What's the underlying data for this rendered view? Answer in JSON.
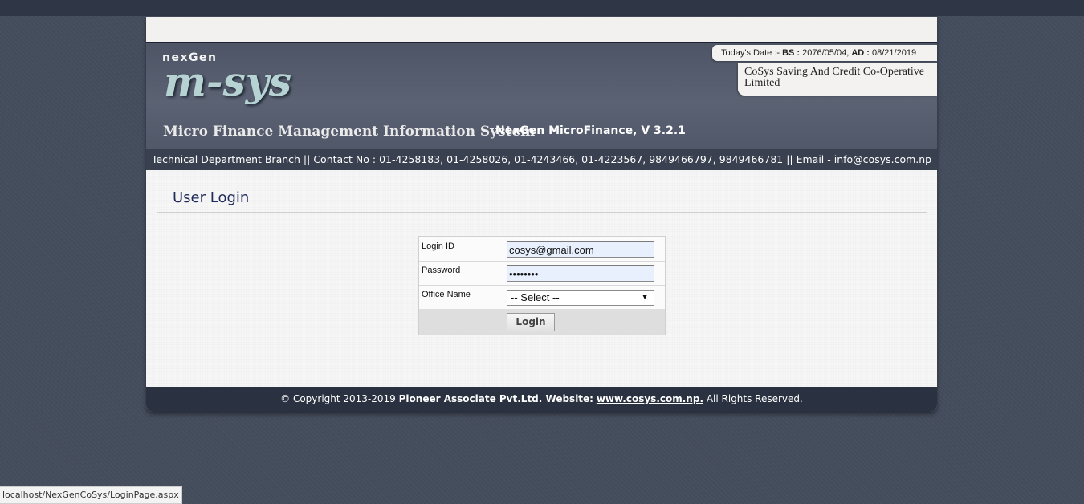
{
  "header": {
    "brand_prefix": "nexGen",
    "product_logo": "m-sys",
    "system_title": "Micro Finance Management Information System",
    "version": "NexGen MicroFinance, V 3.2.1",
    "date_prefix": "Today's Date :-",
    "bs_label": "BS :",
    "bs_date": "2076/05/04,",
    "ad_label": "AD :",
    "ad_date": "08/21/2019",
    "organization": "CoSys Saving And Credit Co-Operative Limited"
  },
  "contact_bar": "Technical Department Branch || Contact No : 01-4258183, 01-4258026, 01-4243466, 01-4223567, 9849466797, 9849466781 || Email - info@cosys.com.np",
  "login": {
    "title": "User Login",
    "login_id_label": "Login ID",
    "login_id_value": "cosys@gmail.com",
    "password_label": "Password",
    "password_value": "cosys123",
    "office_label": "Office Name",
    "office_selected": "-- Select --",
    "button_label": "Login"
  },
  "footer": {
    "copyright": "© Copyright 2013-2019",
    "company": "Pioneer Associate Pvt.Ltd. Website:",
    "website": "www.cosys.com.np.",
    "rights": "All Rights Reserved."
  },
  "status_bar_url": "localhost/NexGenCoSys/LoginPage.aspx"
}
